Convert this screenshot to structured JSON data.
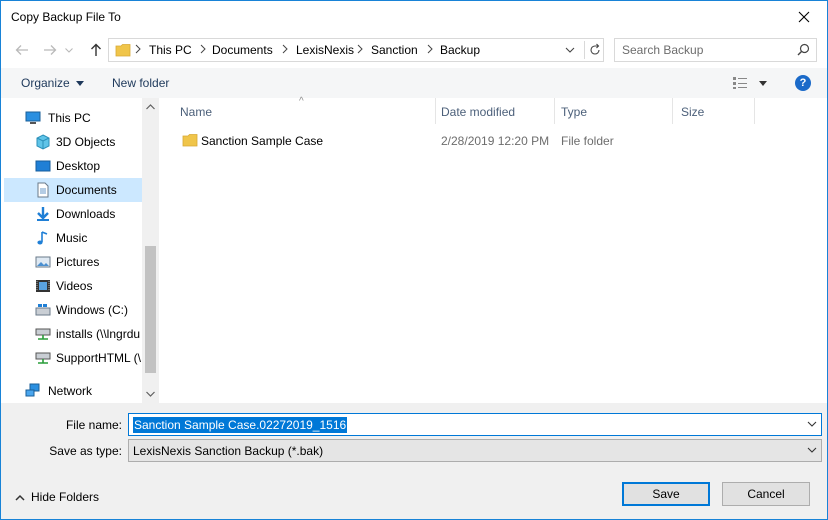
{
  "window": {
    "title": "Copy Backup File To"
  },
  "address": {
    "crumbs": [
      "This PC",
      "Documents",
      "LexisNexis",
      "Sanction",
      "Backup"
    ]
  },
  "search": {
    "placeholder": "Search Backup"
  },
  "toolbar": {
    "organize_label": "Organize",
    "new_folder_label": "New folder",
    "help_label": "?"
  },
  "sidebar": {
    "items": [
      {
        "label": "This PC",
        "icon": "computer-icon"
      },
      {
        "label": "3D Objects",
        "icon": "cube-icon"
      },
      {
        "label": "Desktop",
        "icon": "desktop-icon"
      },
      {
        "label": "Documents",
        "icon": "document-icon",
        "selected": true
      },
      {
        "label": "Downloads",
        "icon": "download-icon"
      },
      {
        "label": "Music",
        "icon": "music-icon"
      },
      {
        "label": "Pictures",
        "icon": "pictures-icon"
      },
      {
        "label": "Videos",
        "icon": "video-icon"
      },
      {
        "label": "Windows (C:)",
        "icon": "drive-icon"
      },
      {
        "label": "installs (\\\\lngrdu",
        "icon": "network-drive-icon"
      },
      {
        "label": "SupportHTML (\\",
        "icon": "network-drive-icon"
      },
      {
        "label": "Network",
        "icon": "network-icon"
      }
    ]
  },
  "files": {
    "columns": [
      "Name",
      "Date modified",
      "Type",
      "Size"
    ],
    "rows": [
      {
        "name": "Sanction Sample Case",
        "date": "2/28/2019 12:20 PM",
        "type": "File folder",
        "size": ""
      }
    ]
  },
  "form": {
    "filename_label": "File name:",
    "filename_value": "Sanction Sample Case.02272019_1516",
    "savetype_label": "Save as type:",
    "savetype_value": "LexisNexis Sanction Backup (*.bak)"
  },
  "footer": {
    "hide_folders_label": "Hide Folders",
    "save_label": "Save",
    "cancel_label": "Cancel"
  },
  "colors": {
    "accent": "#0078d7",
    "selected_bg": "#cce8ff",
    "folder": "#f0c54a"
  }
}
